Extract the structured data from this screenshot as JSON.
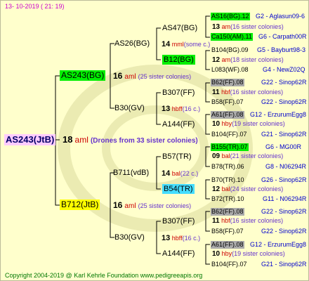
{
  "date": "13- 10-2019 ( 21: 19)",
  "copyright": "Copyright 2004-2019 @ Karl Kehrle Foundation    www.pedigreeapis.org",
  "root": {
    "label": "AS243(JtB)",
    "num": "18",
    "unit": "aml",
    "note": "(Drones from 33 sister colonies)"
  },
  "mother": {
    "label": "AS243(BG)",
    "num": "16",
    "unit": "aml",
    "note": "(25 sister colonies)"
  },
  "father": {
    "label": "B712(JtB)",
    "num": "16",
    "unit": "aml",
    "note": "(25 sister colonies)"
  },
  "g2": [
    {
      "label": "AS26(BG)",
      "num": "14",
      "unit": "mml",
      "note": "(some c.)"
    },
    {
      "label": "B30(GV)",
      "num": "13",
      "unit": "hbff",
      "note": "(16 c.)"
    },
    {
      "label": "B711(vdB)",
      "num": "14",
      "unit": "bal",
      "note": "(22 c.)"
    },
    {
      "label": "B30(GV)",
      "num": "13",
      "unit": "hbff",
      "note": "(16 c.)"
    }
  ],
  "g3": [
    {
      "label": "AS47(BG)",
      "num": "13",
      "unit": "am",
      "note": "(16 sister colonies)"
    },
    {
      "label": "B12(BG)",
      "num": "12",
      "unit": "am",
      "note": "(18 sister colonies)"
    },
    {
      "label": "B307(FF)",
      "num": "11",
      "unit": "hbf",
      "note": "(16 sister colonies)"
    },
    {
      "label": "A144(FF)",
      "num": "10",
      "unit": "hby",
      "note": "(19 sister colonies)"
    },
    {
      "label": "B57(TR)",
      "num": "09",
      "unit": "bal",
      "note": "(21 sister colonies)"
    },
    {
      "label": "B54(TR)",
      "num": "12",
      "unit": "bal",
      "note": "(24 sister colonies)"
    },
    {
      "label": "B307(FF)",
      "num": "11",
      "unit": "hbf",
      "note": "(16 sister colonies)"
    },
    {
      "label": "A144(FF)",
      "num": "10",
      "unit": "hby",
      "note": "(19 sister colonies)"
    }
  ],
  "g4": [
    {
      "label": "AS16(BG).12",
      "info": "G2 - Aglasun09-6"
    },
    {
      "label": "Ca150(AM).11",
      "info": "G6 - Carpath00R"
    },
    {
      "label": "B104(BG).09",
      "info": "G5 - Bayburt98-3"
    },
    {
      "label": "L083(WF).08",
      "info": "G4 - NewZ02Q"
    },
    {
      "label": "B62(FF).08",
      "info": "G22 - Sinop62R"
    },
    {
      "label": "B58(FF).07",
      "info": "G22 - Sinop62R"
    },
    {
      "label": "A61(FF).08",
      "info": "G12 - ErzurumEgg8"
    },
    {
      "label": "B104(FF).07",
      "info": "G21 - Sinop62R"
    },
    {
      "label": "B155(TR).07",
      "info": "G6 - MG00R"
    },
    {
      "label": "B78(TR).06",
      "info": "G8 - N06294R"
    },
    {
      "label": "B70(TR).10",
      "info": "G26 - Sinop62R"
    },
    {
      "label": "B72(TR).10",
      "info": "G11 - N06294R"
    },
    {
      "label": "B62(FF).08",
      "info": "G22 - Sinop62R"
    },
    {
      "label": "B58(FF).07",
      "info": "G22 - Sinop62R"
    },
    {
      "label": "A61(FF).08",
      "info": "G12 - ErzurumEgg8"
    },
    {
      "label": "B104(FF).07",
      "info": "G21 - Sinop62R"
    }
  ]
}
